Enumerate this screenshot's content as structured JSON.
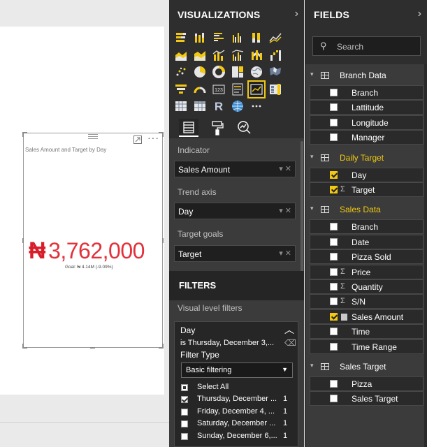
{
  "visual": {
    "title": "Sales Amount and Target by Day",
    "currency_symbol": "₦",
    "kpi_value": "3,762,000",
    "goal_text": "Goal: ₦ 4.14M (-9.09%)",
    "more_label": "···"
  },
  "visualizations": {
    "title": "VISUALIZATIONS",
    "chevron": "›",
    "wells": [
      {
        "label": "Indicator",
        "value": "Sales Amount"
      },
      {
        "label": "Trend axis",
        "value": "Day"
      },
      {
        "label": "Target goals",
        "value": "Target"
      }
    ]
  },
  "filters": {
    "title": "FILTERS",
    "section": "Visual level filters",
    "card": {
      "field": "Day",
      "description": "is Thursday, December 3,...",
      "type_label": "Filter Type",
      "type_value": "Basic filtering",
      "items": [
        {
          "label": "Select All",
          "count": ""
        },
        {
          "label": "Thursday, December ...",
          "count": "1"
        },
        {
          "label": "Friday, December 4, ...",
          "count": "1"
        },
        {
          "label": "Saturday, December ...",
          "count": "1"
        },
        {
          "label": "Sunday, December 6,...",
          "count": "1"
        }
      ]
    }
  },
  "fields": {
    "title": "FIELDS",
    "chevron": "›",
    "search_placeholder": "Search",
    "tables": [
      {
        "name": "Branch Data",
        "fields": [
          {
            "name": "Branch",
            "sigma": false,
            "checked": false
          },
          {
            "name": "Lattitude",
            "sigma": false,
            "checked": false
          },
          {
            "name": "Longitude",
            "sigma": false,
            "checked": false
          },
          {
            "name": "Manager",
            "sigma": false,
            "checked": false
          }
        ]
      },
      {
        "name": "Daily Target",
        "active": true,
        "fields": [
          {
            "name": "Day",
            "sigma": false,
            "checked": true
          },
          {
            "name": "Target",
            "sigma": true,
            "checked": true
          }
        ]
      },
      {
        "name": "Sales Data",
        "active": true,
        "fields": [
          {
            "name": "Branch",
            "sigma": false,
            "checked": false
          },
          {
            "name": "Date",
            "sigma": false,
            "checked": false
          },
          {
            "name": "Pizza Sold",
            "sigma": false,
            "checked": false
          },
          {
            "name": "Price",
            "sigma": true,
            "checked": false
          },
          {
            "name": "Quantity",
            "sigma": true,
            "checked": false
          },
          {
            "name": "S/N",
            "sigma": true,
            "checked": false
          },
          {
            "name": "Sales Amount",
            "sigma": false,
            "calc": true,
            "checked": true
          },
          {
            "name": "Time",
            "sigma": false,
            "checked": false
          },
          {
            "name": "Time Range",
            "sigma": false,
            "checked": false
          }
        ]
      },
      {
        "name": "Sales Target",
        "fields": [
          {
            "name": "Pizza",
            "sigma": false,
            "checked": false
          },
          {
            "name": "Sales Target",
            "sigma": false,
            "checked": false
          }
        ]
      }
    ]
  },
  "colors": {
    "accent": "#f2c811",
    "kpi_red": "#e2313b",
    "pane_dark": "#2e2e2e",
    "pane_mid": "#3b3b3b"
  },
  "icons": {
    "viz_types": [
      "stacked-bar-icon",
      "stacked-column-icon",
      "clustered-bar-icon",
      "clustered-column-icon",
      "100-stacked-bar-icon",
      "line-chart-icon",
      "area-chart-icon",
      "stacked-area-icon",
      "line-column-icon",
      "line-clustered-column-icon",
      "ribbon-chart-icon",
      "waterfall-icon",
      "scatter-icon",
      "pie-icon",
      "donut-icon",
      "treemap-icon",
      "map-icon",
      "filled-map-icon",
      "funnel-icon",
      "gauge-icon",
      "card-icon",
      "multirow-card-icon",
      "kpi-icon",
      "slicer-icon",
      "table-icon",
      "matrix-icon",
      "r-visual-icon",
      "globe-icon",
      "more-icon"
    ]
  }
}
